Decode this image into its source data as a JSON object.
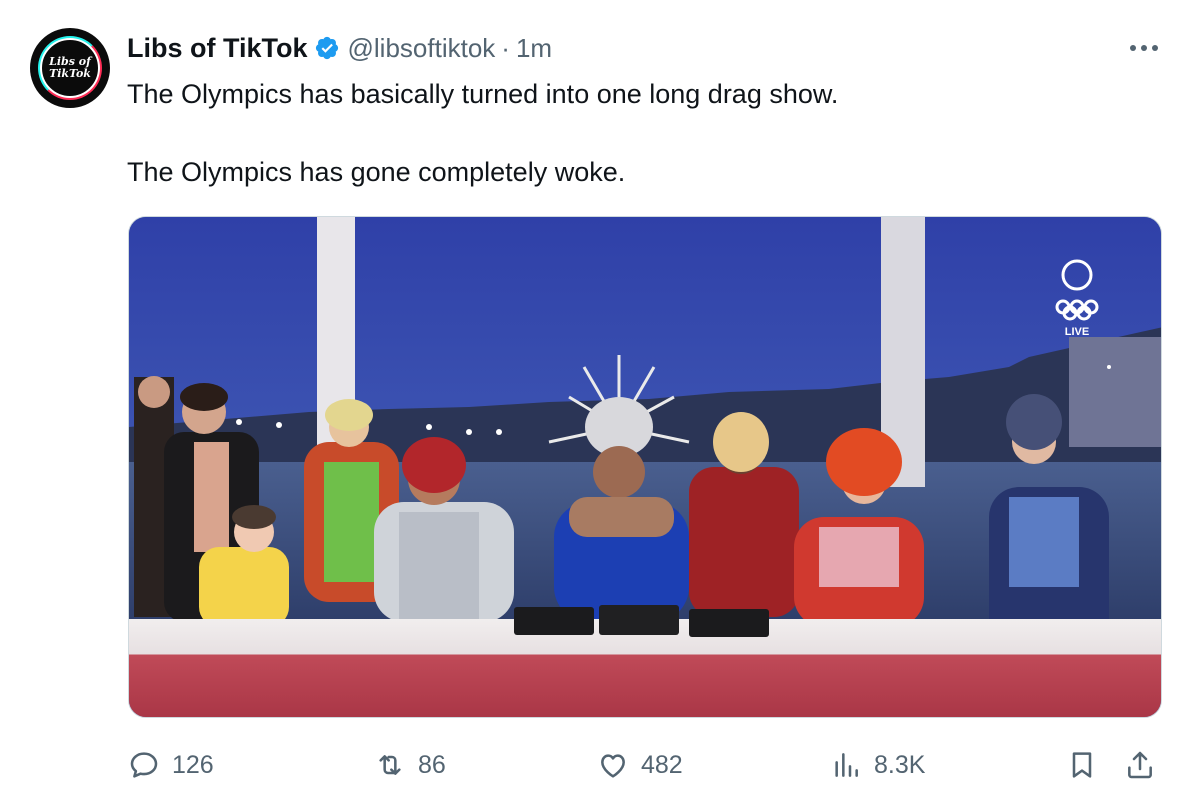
{
  "tweet": {
    "avatar_text_line1": "Libs of",
    "avatar_text_line2": "TikTok",
    "display_name": "Libs of TikTok",
    "handle": "@libsoftiktok",
    "separator": "·",
    "time": "1m",
    "text_line1": "The Olympics has basically turned into one long drag show.",
    "text_line2": "The Olympics has gone completely woke.",
    "verified": true
  },
  "media": {
    "broadcast_badge": "LIVE"
  },
  "actions": {
    "reply_count": "126",
    "retweet_count": "86",
    "like_count": "482",
    "views_count": "8.3K"
  },
  "icons": {
    "more": "more-horizontal-icon",
    "verified": "verified-badge-icon",
    "reply": "reply-icon",
    "retweet": "retweet-icon",
    "like": "heart-icon",
    "views": "views-icon",
    "bookmark": "bookmark-icon",
    "share": "share-icon"
  },
  "colors": {
    "verified": "#1d9bf0",
    "secondary_text": "#536471",
    "primary_text": "#0f1419"
  }
}
